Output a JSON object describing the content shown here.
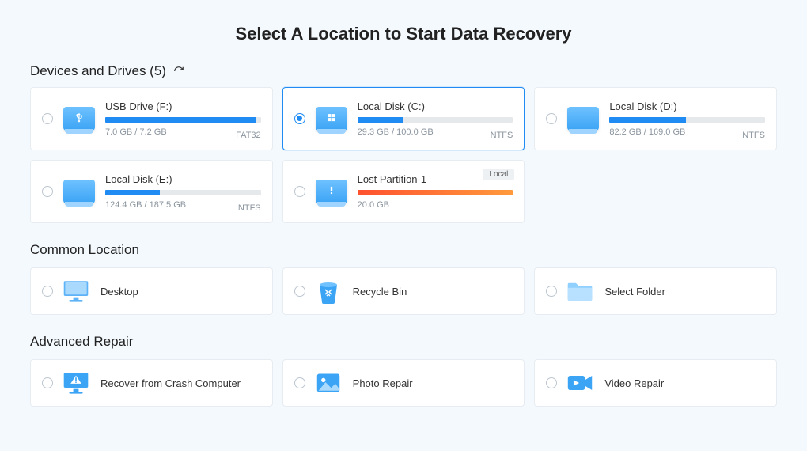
{
  "title": "Select A Location to Start Data Recovery",
  "devices": {
    "header": "Devices and Drives (5)",
    "items": [
      {
        "name": "USB Drive (F:)",
        "size": "7.0 GB / 7.2 GB",
        "fs": "FAT32",
        "fill": 97,
        "icon": "usb",
        "selected": false
      },
      {
        "name": "Local Disk (C:)",
        "size": "29.3 GB / 100.0 GB",
        "fs": "NTFS",
        "fill": 29,
        "icon": "windows",
        "selected": true
      },
      {
        "name": "Local Disk (D:)",
        "size": "82.2 GB / 169.0 GB",
        "fs": "NTFS",
        "fill": 49,
        "icon": "disk",
        "selected": false
      },
      {
        "name": "Local Disk (E:)",
        "size": "124.4 GB / 187.5 GB",
        "fs": "NTFS",
        "fill": 35,
        "icon": "disk",
        "selected": false
      },
      {
        "name": "Lost Partition-1",
        "size": "20.0 GB",
        "fs": "",
        "fill": 100,
        "icon": "warning",
        "selected": false,
        "tag": "Local",
        "orange": true
      }
    ]
  },
  "common": {
    "header": "Common Location",
    "items": [
      {
        "label": "Desktop",
        "icon": "desktop"
      },
      {
        "label": "Recycle Bin",
        "icon": "recycle"
      },
      {
        "label": "Select Folder",
        "icon": "folder"
      }
    ]
  },
  "advanced": {
    "header": "Advanced Repair",
    "items": [
      {
        "label": "Recover from Crash Computer",
        "icon": "crash"
      },
      {
        "label": "Photo Repair",
        "icon": "photo"
      },
      {
        "label": "Video Repair",
        "icon": "video"
      }
    ]
  }
}
